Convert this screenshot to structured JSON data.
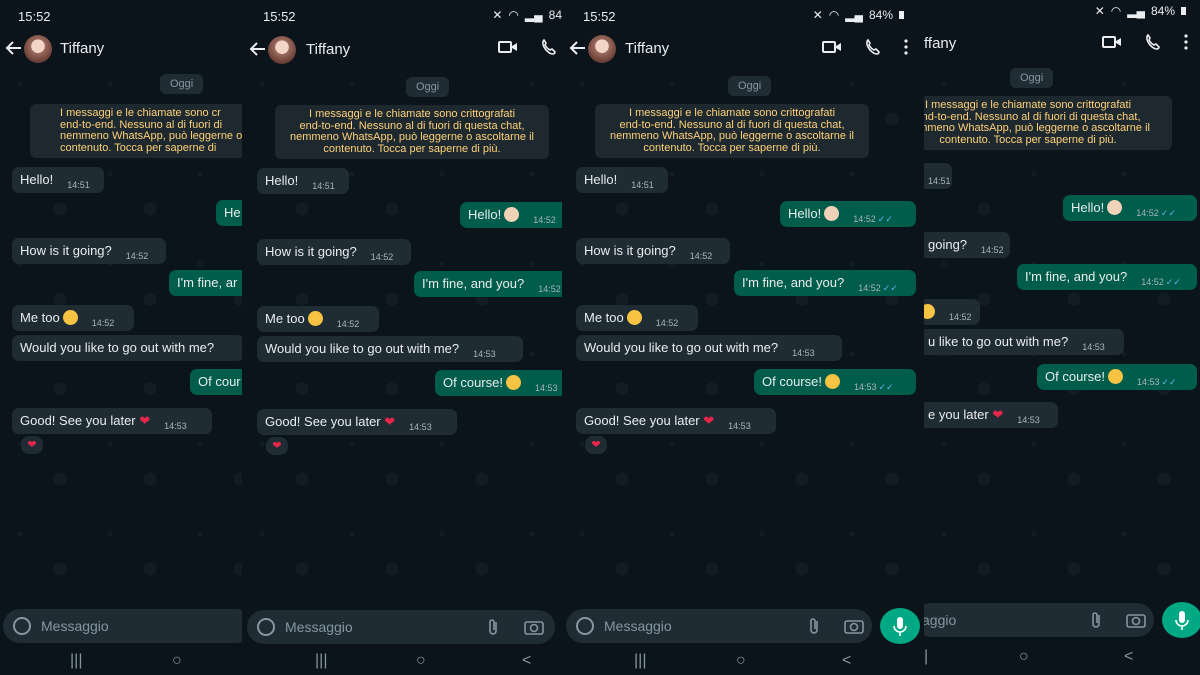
{
  "status": {
    "time": "15:52",
    "battery": "84%",
    "battery_cut": "84"
  },
  "contact": {
    "name": "Tiffany"
  },
  "chat": {
    "date_label": "Oggi",
    "encryption_notice": [
      "I messaggi e le chiamate sono crittografati",
      "end-to-end. Nessuno al di fuori di questa chat,",
      "nemmeno WhatsApp, può leggerne o ascoltarne il",
      "contenuto. Tocca per saperne di più."
    ],
    "messages": [
      {
        "dir": "in",
        "text": "Hello!",
        "time": "14:51"
      },
      {
        "dir": "out",
        "text": "Hello!",
        "emoji": "waving-hand",
        "time": "14:52"
      },
      {
        "dir": "in",
        "text": "How is it going?",
        "time": "14:52"
      },
      {
        "dir": "out",
        "text": "I'm fine, and you?",
        "time": "14:52"
      },
      {
        "dir": "in",
        "text": "Me too",
        "emoji": "smiling-face-with-hearts",
        "time": "14:52"
      },
      {
        "dir": "in",
        "text": "Would you like to go out with me?",
        "time": "14:53"
      },
      {
        "dir": "out",
        "text": "Of course!",
        "emoji": "heart-eyes",
        "time": "14:53"
      },
      {
        "dir": "in",
        "text": "Good! See you later",
        "emoji": "red-heart",
        "time": "14:53"
      }
    ],
    "reaction": "❤",
    "cropped": {
      "hello_out": "He",
      "fine_out": "I'm fine, ar",
      "course_out": "Of cour",
      "contact_right": "ffany",
      "notice_right": [
        "I messaggi e le chiamate sono crittografati",
        "end-to-end. Nessuno al di fuori di questa chat,",
        "nemmeno WhatsApp, può leggerne o ascoltarne il",
        "contenuto. Tocca per saperne di più."
      ],
      "going_right": "going?",
      "metoo_time": "14:52",
      "would_right": "u like to go out with me?",
      "later_right": "e you later",
      "input_right": "aggio",
      "notice_left": [
        "I messaggi e le chiamate sono cr",
        "end-to-end. Nessuno al di fuori di",
        "nemmeno WhatsApp, può leggerne o",
        "contenuto. Tocca per saperne di"
      ]
    }
  },
  "input": {
    "placeholder": "Messaggio"
  },
  "nav": {
    "recents": "|||",
    "home": "○",
    "back": "<"
  },
  "colors": {
    "bg": "#0b141a",
    "incoming": "#202c33",
    "outgoing": "#005c4b",
    "accent": "#00a884",
    "notice_text": "#ffd279"
  }
}
